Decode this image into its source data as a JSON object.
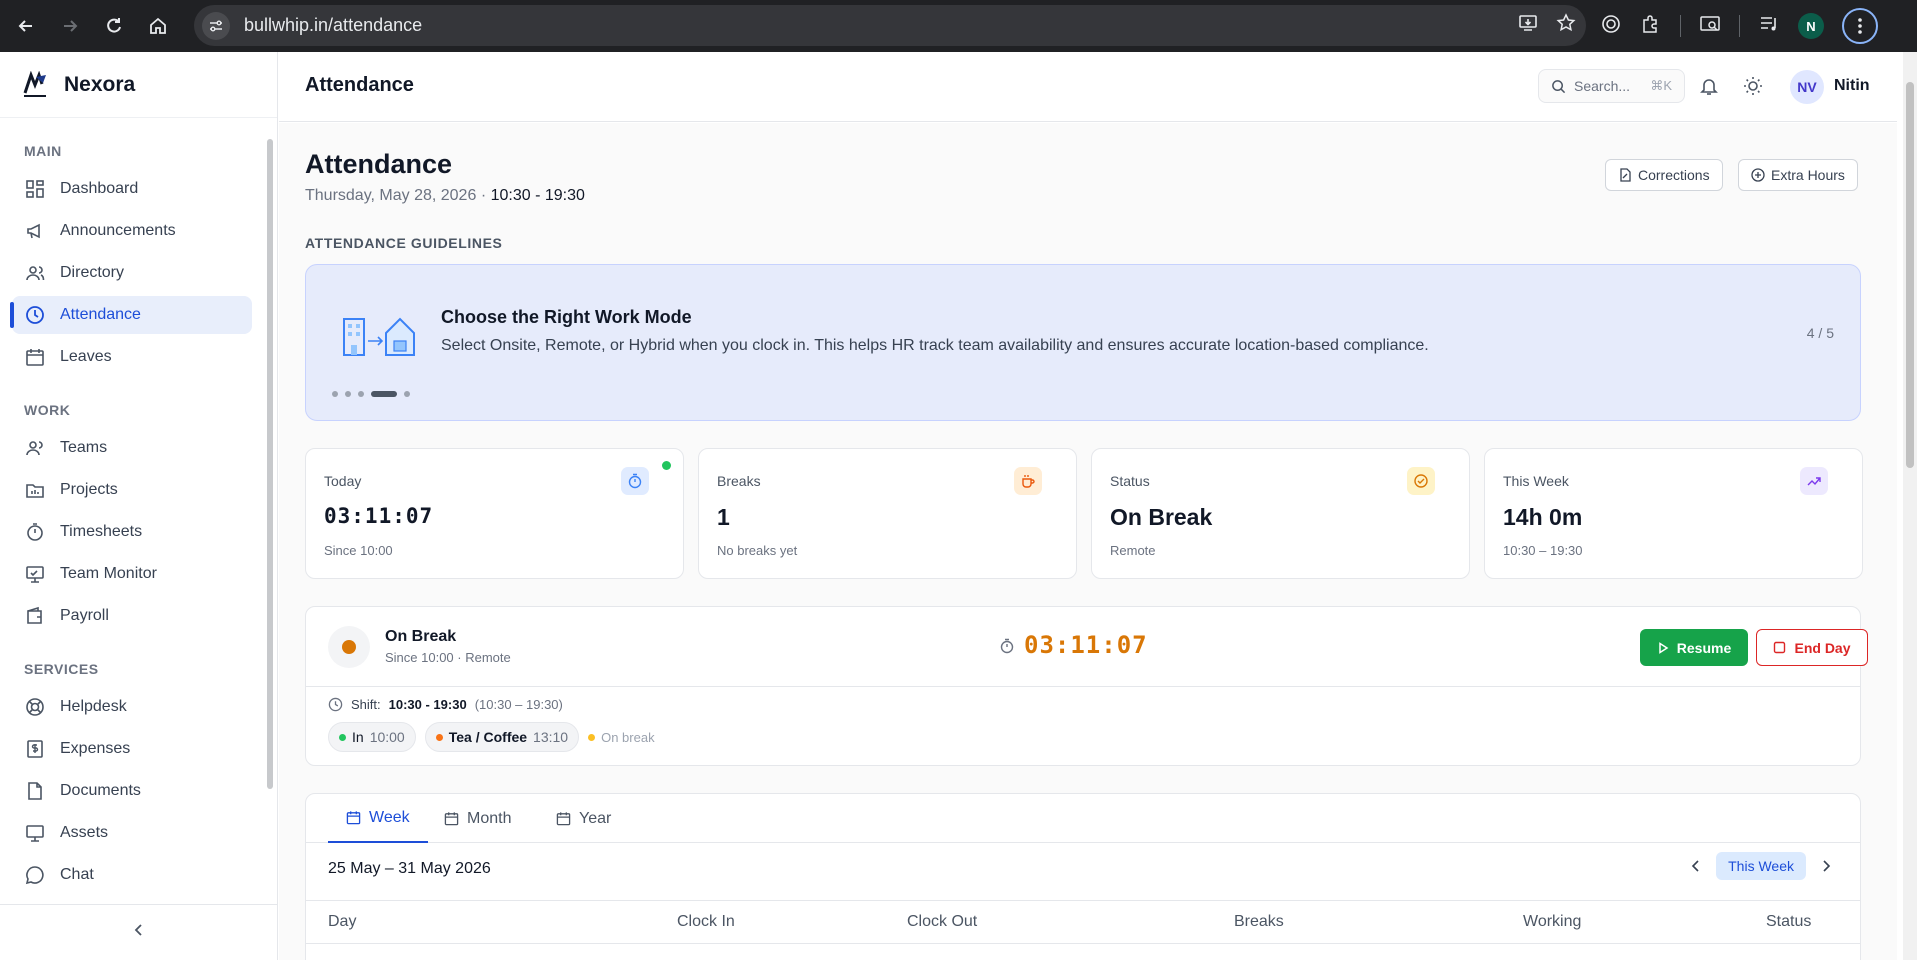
{
  "browser": {
    "url": "bullwhip.in/attendance",
    "profile_initial": "N"
  },
  "sidebar": {
    "brand": "Nexora",
    "sections": {
      "main": "MAIN",
      "work": "WORK",
      "services": "SERVICES"
    },
    "items": [
      {
        "label": "Dashboard",
        "icon": "dashboard-icon"
      },
      {
        "label": "Announcements",
        "icon": "megaphone-icon"
      },
      {
        "label": "Directory",
        "icon": "users-icon"
      },
      {
        "label": "Attendance",
        "icon": "clock-icon",
        "active": true
      },
      {
        "label": "Leaves",
        "icon": "calendar-icon"
      },
      {
        "label": "Teams",
        "icon": "team-icon"
      },
      {
        "label": "Projects",
        "icon": "folder-icon"
      },
      {
        "label": "Timesheets",
        "icon": "stopwatch-icon"
      },
      {
        "label": "Team Monitor",
        "icon": "monitor-icon"
      },
      {
        "label": "Payroll",
        "icon": "wallet-icon"
      },
      {
        "label": "Helpdesk",
        "icon": "lifebuoy-icon"
      },
      {
        "label": "Expenses",
        "icon": "receipt-icon"
      },
      {
        "label": "Documents",
        "icon": "file-icon"
      },
      {
        "label": "Assets",
        "icon": "laptop-icon"
      },
      {
        "label": "Chat",
        "icon": "chat-icon"
      }
    ]
  },
  "header": {
    "title": "Attendance",
    "search_placeholder": "Search...",
    "search_shortcut": "⌘K",
    "user_initials": "NV",
    "user_name": "Nitin"
  },
  "page": {
    "title": "Attendance",
    "date": "Thursday, May 28, 2026",
    "separator": "·",
    "shift_hours": "10:30 - 19:30",
    "corrections_label": "Corrections",
    "extra_hours_label": "Extra Hours"
  },
  "guidelines": {
    "section_label": "ATTENDANCE GUIDELINES",
    "title": "Choose the Right Work Mode",
    "text": "Select Onsite, Remote, or Hybrid when you clock in. This helps HR track team availability and ensures accurate location-based compliance.",
    "counter": "4 / 5",
    "current": 4,
    "total": 5
  },
  "stats": [
    {
      "label": "Today",
      "value": "03:11:07",
      "sub": "Since 10:00",
      "icon": "stopwatch-icon",
      "color": "#3b82f6",
      "bg": "#e0ebff"
    },
    {
      "label": "Breaks",
      "value": "1",
      "sub": "No breaks yet",
      "icon": "coffee-icon",
      "color": "#ea580c",
      "bg": "#ffedd5"
    },
    {
      "label": "Status",
      "value": "On Break",
      "sub": "Remote",
      "icon": "check-circle-icon",
      "color": "#d97706",
      "bg": "#fef3c7"
    },
    {
      "label": "This Week",
      "value": "14h 0m",
      "sub": "10:30 – 19:30",
      "icon": "trending-up-icon",
      "color": "#7c3aed",
      "bg": "#ede9fe"
    }
  ],
  "session": {
    "status": "On Break",
    "sub": "Since 10:00 · Remote",
    "timer": "03:11:07",
    "resume_label": "Resume",
    "end_day_label": "End Day",
    "shift_label": "Shift:",
    "shift_value": "10:30 - 19:30",
    "shift_range": "(10:30 – 19:30)",
    "events": [
      {
        "label": "In",
        "time": "10:00",
        "color": "#22c55e"
      },
      {
        "label": "Tea / Coffee",
        "time": "13:10",
        "color": "#f97316"
      }
    ],
    "on_break_label": "On break"
  },
  "history": {
    "tabs": [
      "Week",
      "Month",
      "Year"
    ],
    "active_tab": "Week",
    "range": "25 May – 31 May 2026",
    "this_week_label": "This Week",
    "columns": [
      "Day",
      "Clock In",
      "Clock Out",
      "Breaks",
      "Working",
      "Status"
    ]
  }
}
